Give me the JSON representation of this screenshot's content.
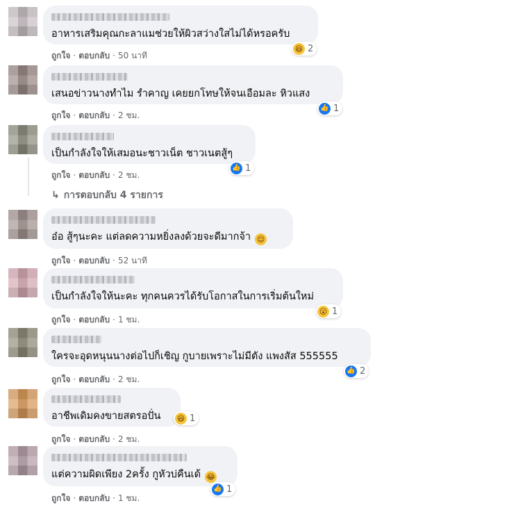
{
  "comments": [
    {
      "text": "อาหารเสริมคุณกะลาแมช่วยให้ผิวสว่างใสไม่ได้หรอครับ",
      "like": "ถูกใจ",
      "reply": "ตอบกลับ",
      "time": "50 นาที",
      "reaction": {
        "icon": "haha-icon",
        "count": "2"
      },
      "avatar_color": "#c9c0c4"
    },
    {
      "text": "เสนอข่าวนางทำไม รำคาญ เคยยกโทษให้จนเอือมละ หิวแสง",
      "like": "ถูกใจ",
      "reply": "ตอบกลับ",
      "time": "2 ชม.",
      "reaction": {
        "icon": "like-icon",
        "count": "1"
      },
      "avatar_color": "#9a8a86"
    },
    {
      "text": "เป็นกำลังใจให้เสมอนะชาวเน็ต ชาวเนตสู้ๆ",
      "like": "ถูกใจ",
      "reply": "ตอบกลับ",
      "time": "2 ชม.",
      "reaction": {
        "icon": "like-icon",
        "count": "1"
      },
      "avatar_color": "#8e8e80"
    },
    {
      "text": "อ๋อ สู้ๆนะคะ แต่ลดความหยิ่งลงด้วยจะดีมากจ้า",
      "like": "ถูกใจ",
      "reply": "ตอบกลับ",
      "time": "52 นาที",
      "reaction": null,
      "inline_emoji": "relieved-emoji-icon",
      "avatar_color": "#a29390"
    },
    {
      "text": "เป็นกำลังใจให้นะคะ ทุกคนควรได้รับโอกาสในการเริ่มต้นใหม่",
      "like": "ถูกใจ",
      "reply": "ตอบกลับ",
      "time": "1 ชม.",
      "reaction": {
        "icon": "wow-icon",
        "count": "1"
      },
      "avatar_color": "#d4a8b2"
    },
    {
      "text": "ใครจะอุดหนุนนางต่อไปก็เชิญ กูบายเพราะไม่มีตัง แพงสัส 555555",
      "like": "ถูกใจ",
      "reply": "ตอบกลับ",
      "time": "2 ชม.",
      "reaction": {
        "icon": "like-icon",
        "count": "2"
      },
      "avatar_color": "#8f8a78"
    },
    {
      "text": "อาชีพเดิมคงขายสตรอปั่น",
      "like": "ถูกใจ",
      "reply": "ตอบกลับ",
      "time": "2 ชม.",
      "reaction": {
        "icon": "haha-icon",
        "count": "1"
      },
      "avatar_color": "#d89a5a"
    },
    {
      "text": "แต่ความผิดเพียง 2ครั้ง กูหัวบ่คืนเด้",
      "like": "ถูกใจ",
      "reply": "ตอบกลับ",
      "time": "1 ชม.",
      "reaction": {
        "icon": "like-icon",
        "count": "1"
      },
      "inline_emoji": "laughing-tears-emoji-icon",
      "avatar_color": "#b69ea8"
    }
  ],
  "replies_link": "การตอบกลับ 4 รายการ",
  "separator": "·"
}
